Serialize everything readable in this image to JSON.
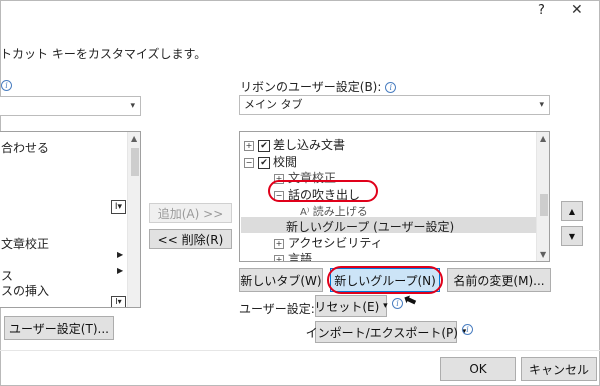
{
  "title_bar": {
    "help": "?",
    "close": "✕"
  },
  "header": {
    "description": "トカット キーをカスタマイズします。"
  },
  "left": {
    "combo_value": "",
    "items": [
      "合わせる",
      "文章校正",
      "ス",
      "スの挿入"
    ]
  },
  "middle": {
    "add_button": "追加(A) >>",
    "remove_button": "<< 削除(R)"
  },
  "ribbon": {
    "label": "リボンのユーザー設定(B):",
    "combo_value": "メイン タブ",
    "tree": {
      "mail_merge": "差し込み文書",
      "review": "校閲",
      "proofing": "文章校正",
      "speech_bubble": "話の吹き出し",
      "read_aloud": "読み上げる",
      "new_group": "新しいグループ (ユーザー設定)",
      "accessibility": "アクセシビリティ",
      "language": "言語"
    }
  },
  "buttons": {
    "new_tab": "新しいタブ(W)",
    "new_group": "新しいグループ(N)",
    "rename": "名前の変更(M)...",
    "user_settings_label": "ユーザー設定:",
    "reset": "リセット(E)",
    "import_export": "インポート/エクスポート(P)",
    "keyboard_customize": "ユーザー設定(T)...",
    "ok": "OK",
    "cancel": "キャンセル"
  },
  "icons": {
    "info": "i",
    "expand_plus": "+",
    "expand_minus": "−",
    "dropdown": "▾",
    "up": "▲",
    "down": "▼"
  },
  "colors": {
    "highlight": "#e0001a",
    "selection": "#dcdcdc",
    "accent": "#0078d7"
  }
}
